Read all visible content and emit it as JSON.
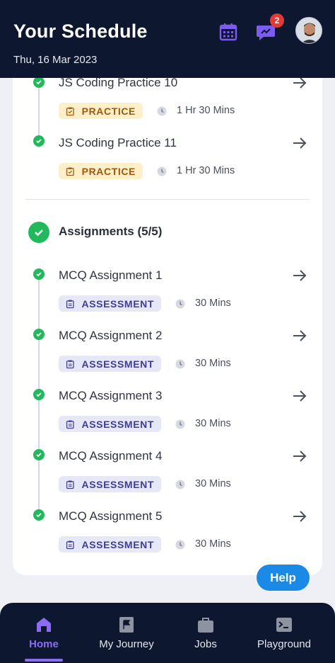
{
  "header": {
    "title": "Your Schedule",
    "date": "Thu, 16 Mar 2023",
    "calendar_icon": "calendar-icon",
    "chat_icon": "chat-icon",
    "notification_count": "2",
    "accent": "#7c5cf0"
  },
  "practice_items": [
    {
      "title": "JS Coding Practice 10",
      "tag": "PRACTICE",
      "duration": "1 Hr 30 Mins"
    },
    {
      "title": "JS Coding Practice 11",
      "tag": "PRACTICE",
      "duration": "1 Hr 30 Mins"
    }
  ],
  "assignments": {
    "section_title": "Assignments (5/5)",
    "items": [
      {
        "title": "MCQ Assignment 1",
        "tag": "ASSESSMENT",
        "duration": "30 Mins"
      },
      {
        "title": "MCQ Assignment 2",
        "tag": "ASSESSMENT",
        "duration": "30 Mins"
      },
      {
        "title": "MCQ Assignment 3",
        "tag": "ASSESSMENT",
        "duration": "30 Mins"
      },
      {
        "title": "MCQ Assignment 4",
        "tag": "ASSESSMENT",
        "duration": "30 Mins"
      },
      {
        "title": "MCQ Assignment 5",
        "tag": "ASSESSMENT",
        "duration": "30 Mins"
      }
    ]
  },
  "help_label": "Help",
  "nav": {
    "items": [
      {
        "label": "Home",
        "icon": "home-icon",
        "active": true
      },
      {
        "label": "My Journey",
        "icon": "flag-icon",
        "active": false
      },
      {
        "label": "Jobs",
        "icon": "briefcase-icon",
        "active": false
      },
      {
        "label": "Playground",
        "icon": "terminal-icon",
        "active": false
      }
    ]
  },
  "colors": {
    "header_bg": "#0e1730",
    "success": "#22b95c",
    "practice_bg": "#fdf0c8",
    "practice_text": "#a2570c",
    "assessment_bg": "#e6e7f7",
    "assessment_text": "#3d3d99",
    "help_bg": "#1b8ae6",
    "nav_active": "#8b6cf2"
  }
}
